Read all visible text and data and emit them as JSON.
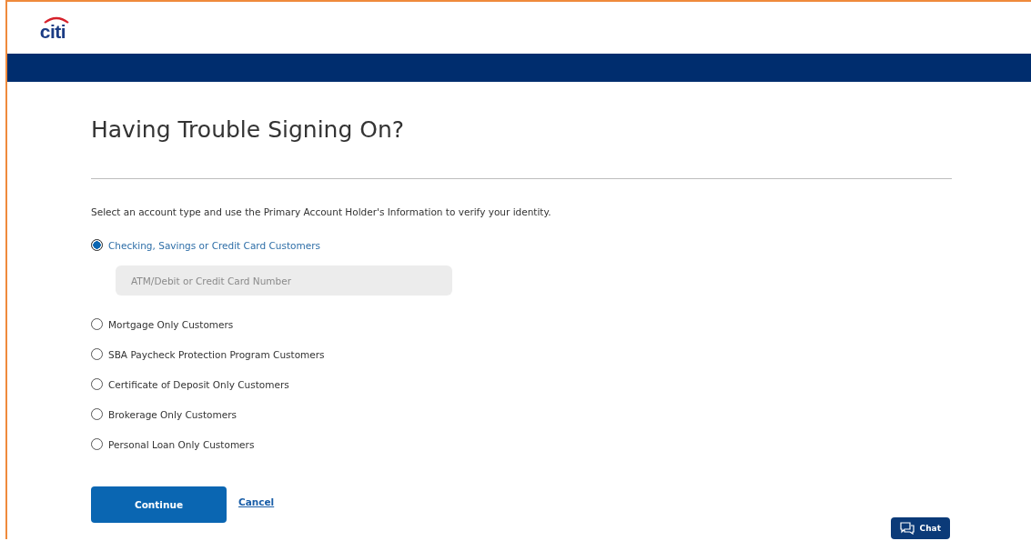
{
  "header": {
    "logo": "citi"
  },
  "title": "Having Trouble Signing On?",
  "intro": "Select an account type and use the Primary Account Holder's Information to verify your identity.",
  "options": [
    {
      "label": "Checking, Savings or Credit Card Customers",
      "selected": true,
      "field": {
        "placeholder": "ATM/Debit or Credit Card Number"
      }
    },
    {
      "label": "Mortgage Only Customers",
      "selected": false
    },
    {
      "label": "SBA Paycheck Protection Program Customers",
      "selected": false
    },
    {
      "label": "Certificate of Deposit Only Customers",
      "selected": false
    },
    {
      "label": "Brokerage Only Customers",
      "selected": false
    },
    {
      "label": "Personal Loan Only Customers",
      "selected": false
    }
  ],
  "buttons": {
    "primary": "Continue",
    "link": "Cancel"
  },
  "chat": {
    "label": "Chat"
  }
}
